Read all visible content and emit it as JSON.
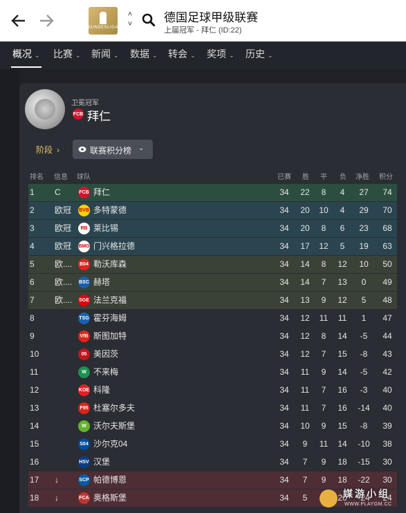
{
  "header": {
    "title": "德国足球甲级联赛",
    "subtitle": "上届冠军 - 拜仁 (ID:22)",
    "logo_text": "BUNDESLIGA"
  },
  "tabs": [
    {
      "label": "概况",
      "active": true
    },
    {
      "label": "比赛",
      "active": false
    },
    {
      "label": "新闻",
      "active": false
    },
    {
      "label": "数据",
      "active": false
    },
    {
      "label": "转会",
      "active": false
    },
    {
      "label": "奖项",
      "active": false
    },
    {
      "label": "历史",
      "active": false
    }
  ],
  "champion": {
    "label": "卫冕冠军",
    "name": "拜仁"
  },
  "stage_label": "阶段",
  "view_select": "联赛积分榜",
  "columns": {
    "rank": "排名",
    "info": "信息",
    "team": "球队",
    "played": "已赛",
    "won": "胜",
    "drawn": "平",
    "lost": "负",
    "gd": "净胜",
    "pts": "积分"
  },
  "colors": {
    "zone_champion": "#2c4e41",
    "zone_ucl": "#2b4550",
    "zone_uel": "#3a4237",
    "zone_relegation": "#4e2d35",
    "gold": "#e0c06a"
  },
  "rows": [
    {
      "rank": "1",
      "info": "C",
      "team": "拜仁",
      "p": "34",
      "w": "22",
      "d": "8",
      "l": "4",
      "gd": "27",
      "pts": "74",
      "zone": "champion",
      "crest": "#d1142d",
      "crest_text": "FCB"
    },
    {
      "rank": "2",
      "info": "欧冠",
      "team": "多特蒙德",
      "p": "34",
      "w": "20",
      "d": "10",
      "l": "4",
      "gd": "29",
      "pts": "70",
      "zone": "ucl",
      "crest": "#f5d300",
      "crest_text": "BVB"
    },
    {
      "rank": "3",
      "info": "欧冠",
      "team": "莱比锡",
      "p": "34",
      "w": "20",
      "d": "8",
      "l": "6",
      "gd": "23",
      "pts": "68",
      "zone": "ucl",
      "crest": "#ffffff",
      "crest_text": "RB"
    },
    {
      "rank": "4",
      "info": "欧冠",
      "team": "门兴格拉德",
      "p": "34",
      "w": "17",
      "d": "12",
      "l": "5",
      "gd": "19",
      "pts": "63",
      "zone": "ucl",
      "crest": "#ffffff",
      "crest_text": "BMG"
    },
    {
      "rank": "5",
      "info": "欧....",
      "team": "勒沃库森",
      "p": "34",
      "w": "14",
      "d": "8",
      "l": "12",
      "gd": "10",
      "pts": "50",
      "zone": "uel",
      "crest": "#e32221",
      "crest_text": "B04"
    },
    {
      "rank": "6",
      "info": "欧....",
      "team": "赫塔",
      "p": "34",
      "w": "14",
      "d": "7",
      "l": "13",
      "gd": "0",
      "pts": "49",
      "zone": "uel",
      "crest": "#1b5fa8",
      "crest_text": "BSC"
    },
    {
      "rank": "7",
      "info": "欧....",
      "team": "法兰克福",
      "p": "34",
      "w": "13",
      "d": "9",
      "l": "12",
      "gd": "5",
      "pts": "48",
      "zone": "uel",
      "crest": "#e1000f",
      "crest_text": "SGE"
    },
    {
      "rank": "8",
      "info": "",
      "team": "霍芬海姆",
      "p": "34",
      "w": "12",
      "d": "11",
      "l": "11",
      "gd": "1",
      "pts": "47",
      "zone": "none",
      "crest": "#1961b5",
      "crest_text": "TSG"
    },
    {
      "rank": "9",
      "info": "",
      "team": "斯图加特",
      "p": "34",
      "w": "12",
      "d": "8",
      "l": "14",
      "gd": "-5",
      "pts": "44",
      "zone": "none",
      "crest": "#e32219",
      "crest_text": "VfB"
    },
    {
      "rank": "10",
      "info": "",
      "team": "美因茨",
      "p": "34",
      "w": "12",
      "d": "7",
      "l": "15",
      "gd": "-8",
      "pts": "43",
      "zone": "none",
      "crest": "#c3141e",
      "crest_text": "05"
    },
    {
      "rank": "11",
      "info": "",
      "team": "不来梅",
      "p": "34",
      "w": "11",
      "d": "9",
      "l": "14",
      "gd": "-5",
      "pts": "42",
      "zone": "none",
      "crest": "#1d9053",
      "crest_text": "W"
    },
    {
      "rank": "12",
      "info": "",
      "team": "科隆",
      "p": "34",
      "w": "11",
      "d": "7",
      "l": "16",
      "gd": "-3",
      "pts": "40",
      "zone": "none",
      "crest": "#ed1c24",
      "crest_text": "KOE"
    },
    {
      "rank": "13",
      "info": "",
      "team": "杜塞尔多夫",
      "p": "34",
      "w": "11",
      "d": "7",
      "l": "16",
      "gd": "-14",
      "pts": "40",
      "zone": "none",
      "crest": "#da251d",
      "crest_text": "F95"
    },
    {
      "rank": "14",
      "info": "",
      "team": "沃尔夫斯堡",
      "p": "34",
      "w": "10",
      "d": "9",
      "l": "15",
      "gd": "-8",
      "pts": "39",
      "zone": "none",
      "crest": "#65b32e",
      "crest_text": "W"
    },
    {
      "rank": "15",
      "info": "",
      "team": "沙尔克04",
      "p": "34",
      "w": "9",
      "d": "11",
      "l": "14",
      "gd": "-10",
      "pts": "38",
      "zone": "none",
      "crest": "#004d9d",
      "crest_text": "S04"
    },
    {
      "rank": "16",
      "info": "",
      "team": "汉堡",
      "p": "34",
      "w": "7",
      "d": "9",
      "l": "18",
      "gd": "-15",
      "pts": "30",
      "zone": "none",
      "crest": "#0a3f86",
      "crest_text": "HSV"
    },
    {
      "rank": "17",
      "info": "↓",
      "team": "帕德博恩",
      "p": "34",
      "w": "7",
      "d": "9",
      "l": "18",
      "gd": "-22",
      "pts": "30",
      "zone": "relegation",
      "crest": "#005ca9",
      "crest_text": "SCP"
    },
    {
      "rank": "18",
      "info": "↓",
      "team": "奥格斯堡",
      "p": "34",
      "w": "5",
      "d": "9",
      "l": "20",
      "gd": "-24",
      "pts": "24",
      "zone": "relegation",
      "crest": "#ba3733",
      "crest_text": "FCA"
    }
  ],
  "watermark": {
    "text": "媒游小组",
    "url": "WWW.PLAYGM.CC"
  }
}
